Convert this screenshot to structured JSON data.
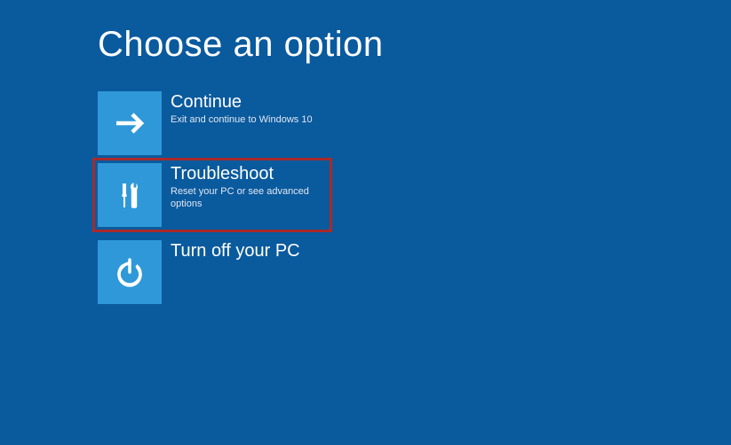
{
  "page": {
    "title": "Choose an option"
  },
  "options": {
    "continue": {
      "title": "Continue",
      "desc": "Exit and continue to Windows 10"
    },
    "troubleshoot": {
      "title": "Troubleshoot",
      "desc": "Reset your PC or see advanced options"
    },
    "turnoff": {
      "title": "Turn off your PC",
      "desc": ""
    }
  },
  "colors": {
    "background": "#0a5a9e",
    "tile": "#2f98d9",
    "highlight": "#a82a2a"
  }
}
